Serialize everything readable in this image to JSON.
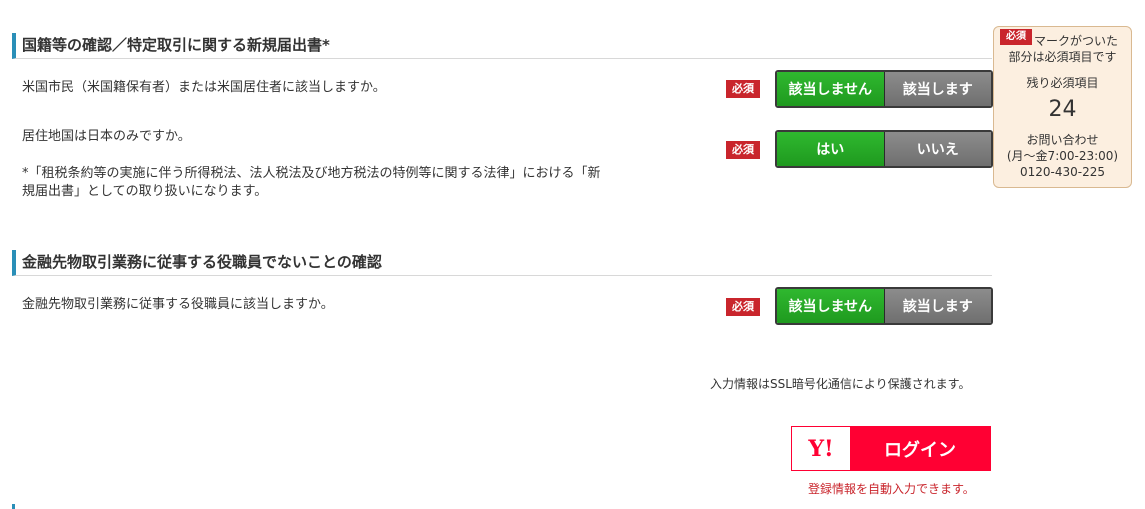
{
  "section1": {
    "title": "国籍等の確認／特定取引に関する新規届出書*",
    "q1": {
      "text": "米国市民（米国籍保有者）または米国居住者に該当しますか。",
      "required": "必須",
      "options": [
        "該当しません",
        "該当します"
      ]
    },
    "q2": {
      "text": "居住地国は日本のみですか。",
      "note_line1": "*「租税条約等の実施に伴う所得税法、法人税法及び地方税法の特例等に関する法律」における「新",
      "note_line2": "規届出書」としての取り扱いになります。",
      "required": "必須",
      "options": [
        "はい",
        "いいえ"
      ]
    }
  },
  "section2": {
    "title": "金融先物取引業務に従事する役職員でないことの確認",
    "q1": {
      "text": "金融先物取引業務に従事する役職員に該当しますか。",
      "required": "必須",
      "options": [
        "該当しません",
        "該当します"
      ]
    }
  },
  "sidebar": {
    "required_badge": "必須",
    "mark_line1": "マークがついた",
    "mark_line2": "部分は必須項目です",
    "remaining_label": "残り必須項目",
    "remaining_count": "24",
    "contact_label": "お問い合わせ",
    "contact_hours": "(月〜金7:00-23:00)",
    "contact_phone": "0120-430-225"
  },
  "ssl_notice": "入力情報はSSL暗号化通信により保護されます。",
  "login": {
    "logo": "Y!",
    "label": "ログイン",
    "autofill_note": "登録情報を自動入力できます。"
  }
}
